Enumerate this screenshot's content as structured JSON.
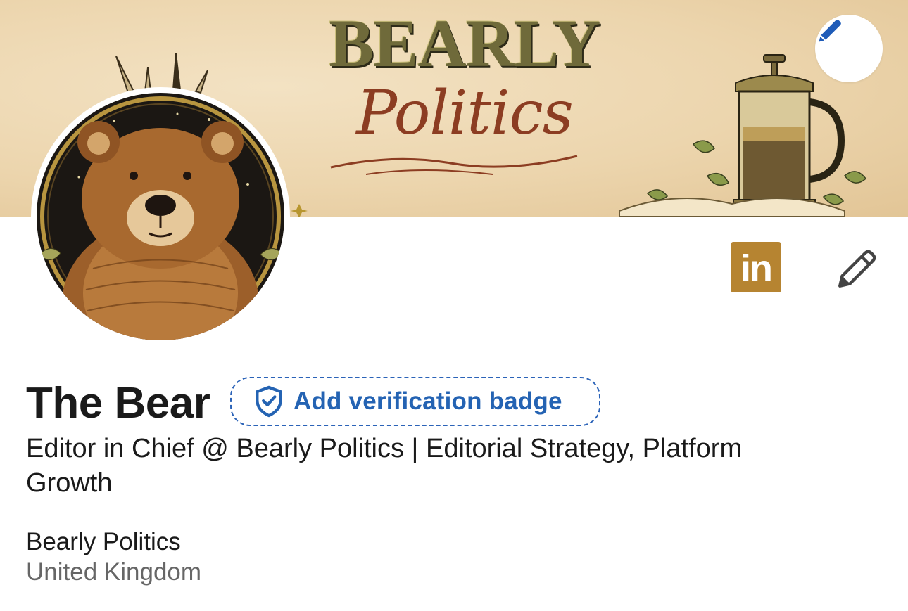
{
  "banner": {
    "title": "BEARLY",
    "subtitle": "Politics",
    "edit_icon": "pencil-icon"
  },
  "avatar": {
    "alt": "bear portrait"
  },
  "actions": {
    "linkedin_label": "in",
    "linkedin_color": "#b68431",
    "edit_icon": "pencil-icon"
  },
  "profile": {
    "name": "The Bear",
    "verification_badge_label": "Add verification badge",
    "verification_icon": "shield-check-icon",
    "headline": "Editor in Chief @ Bearly Politics | Editorial Strategy, Platform Growth",
    "company": "Bearly Politics",
    "location": "United Kingdom"
  },
  "colors": {
    "accent_blue": "#2463b3",
    "text_primary": "#1a1a1a",
    "text_secondary": "#666666",
    "banner_bg": "#ecd5ad"
  }
}
